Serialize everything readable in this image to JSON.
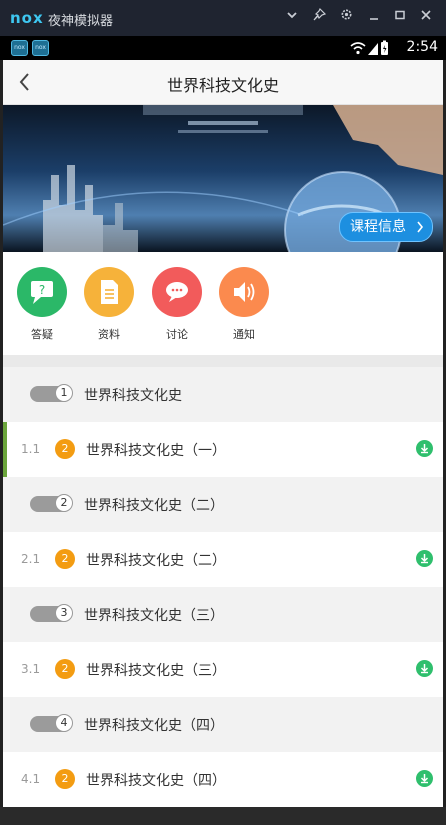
{
  "emulator": {
    "logo": "nox",
    "title": "夜神模拟器",
    "controls": [
      "chevron-down-icon",
      "pin-icon",
      "gear-icon",
      "minimize-icon",
      "maximize-icon",
      "close-icon"
    ]
  },
  "status_bar": {
    "time": "2:54",
    "app_badges": [
      "nox",
      "nox"
    ]
  },
  "header": {
    "title": "世界科技文化史"
  },
  "banner": {
    "course_info_label": "课程信息"
  },
  "quick_actions": [
    {
      "label": "答疑",
      "icon": "qa-icon",
      "color": "#2bb868"
    },
    {
      "label": "资料",
      "icon": "document-icon",
      "color": "#f6b23a"
    },
    {
      "label": "讨论",
      "icon": "discussion-icon",
      "color": "#f25b5b"
    },
    {
      "label": "通知",
      "icon": "speaker-icon",
      "color": "#fb8a4e"
    }
  ],
  "outline": [
    {
      "type": "chapter",
      "number": "1",
      "title": "世界科技文化史"
    },
    {
      "type": "lesson",
      "number": "1.1",
      "badge": "2",
      "title": "世界科技文化史（一）",
      "active": true
    },
    {
      "type": "chapter",
      "number": "2",
      "title": "世界科技文化史（二）"
    },
    {
      "type": "lesson",
      "number": "2.1",
      "badge": "2",
      "title": "世界科技文化史（二）"
    },
    {
      "type": "chapter",
      "number": "3",
      "title": "世界科技文化史（三）"
    },
    {
      "type": "lesson",
      "number": "3.1",
      "badge": "2",
      "title": "世界科技文化史（三）"
    },
    {
      "type": "chapter",
      "number": "4",
      "title": "世界科技文化史（四）"
    },
    {
      "type": "lesson",
      "number": "4.1",
      "badge": "2",
      "title": "世界科技文化史（四）"
    }
  ],
  "colors": {
    "download": "#2fbf6d",
    "badge": "#f39c12",
    "active_marker": "#6ba53b",
    "course_info": "#1d8fe0"
  }
}
